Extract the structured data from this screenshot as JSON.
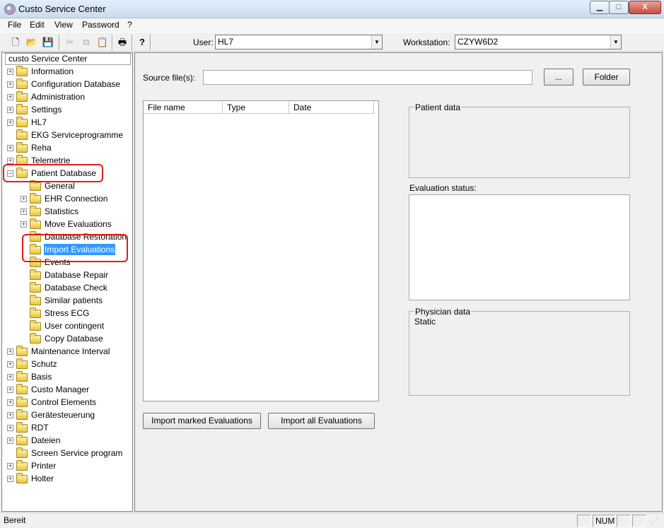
{
  "window": {
    "title": "Custo Service Center",
    "min_label": "▁",
    "max_label": "□",
    "close_label": "X"
  },
  "menu": [
    "File",
    "Edit",
    "View",
    "Password",
    "?"
  ],
  "toolbar": {
    "icons": [
      "new-icon",
      "open-icon",
      "save-icon",
      "cut-icon",
      "copy-icon",
      "paste-icon",
      "print-icon",
      "help-icon"
    ],
    "user_label": "User:",
    "user_value": "HL7",
    "workstation_label": "Workstation:",
    "workstation_value": "CZYW6D2"
  },
  "tree": {
    "root": "custo Service Center",
    "items": [
      {
        "label": "Information",
        "expander": "+",
        "level": 0
      },
      {
        "label": "Configuration Database",
        "expander": "+",
        "level": 0
      },
      {
        "label": "Administration",
        "expander": "+",
        "level": 0
      },
      {
        "label": "Settings",
        "expander": "+",
        "level": 0
      },
      {
        "label": "HL7",
        "expander": "+",
        "level": 0
      },
      {
        "label": "EKG Serviceprogramme",
        "expander": "",
        "level": 0
      },
      {
        "label": "Reha",
        "expander": "+",
        "level": 0
      },
      {
        "label": "Telemetrie",
        "expander": "+",
        "level": 0
      },
      {
        "label": "Patient Database",
        "expander": "−",
        "level": 0
      },
      {
        "label": "General",
        "expander": "",
        "level": 1
      },
      {
        "label": "EHR Connection",
        "expander": "+",
        "level": 1
      },
      {
        "label": "Statistics",
        "expander": "+",
        "level": 1
      },
      {
        "label": "Move Evaluations",
        "expander": "+",
        "level": 1
      },
      {
        "label": "Database Restoration",
        "expander": "",
        "level": 1
      },
      {
        "label": "Import Evaluations",
        "expander": "",
        "level": 1,
        "selected": true
      },
      {
        "label": "Events",
        "expander": "",
        "level": 1
      },
      {
        "label": "Database Repair",
        "expander": "",
        "level": 1
      },
      {
        "label": "Database Check",
        "expander": "",
        "level": 1
      },
      {
        "label": "Similar patients",
        "expander": "",
        "level": 1
      },
      {
        "label": "Stress ECG",
        "expander": "",
        "level": 1
      },
      {
        "label": "User contingent",
        "expander": "",
        "level": 1
      },
      {
        "label": "Copy Database",
        "expander": "",
        "level": 1
      },
      {
        "label": "Maintenance Interval",
        "expander": "+",
        "level": 0
      },
      {
        "label": "Schutz",
        "expander": "+",
        "level": 0
      },
      {
        "label": "Basis",
        "expander": "+",
        "level": 0
      },
      {
        "label": "Custo Manager",
        "expander": "+",
        "level": 0
      },
      {
        "label": "Control Elements",
        "expander": "+",
        "level": 0
      },
      {
        "label": "Gerätesteuerung",
        "expander": "+",
        "level": 0
      },
      {
        "label": "RDT",
        "expander": "+",
        "level": 0
      },
      {
        "label": "Dateien",
        "expander": "+",
        "level": 0
      },
      {
        "label": "Screen Service program",
        "expander": "",
        "level": 0
      },
      {
        "label": "Printer",
        "expander": "+",
        "level": 0
      },
      {
        "label": "Holter",
        "expander": "+",
        "level": 0
      }
    ]
  },
  "main": {
    "source_label": "Source file(s):",
    "source_value": "",
    "browse_label": "...",
    "folder_label": "Folder",
    "columns": [
      "File name",
      "Type",
      "Date"
    ],
    "patient_data_title": "Patient data",
    "evaluation_status_label": "Evaluation status:",
    "physician_data_title": "Physician data",
    "physician_data_value": "Static",
    "import_marked_label": "Import marked Evaluations",
    "import_all_label": "Import all Evaluations"
  },
  "status": {
    "text": "Bereit",
    "num": "NUM"
  },
  "colors": {
    "selection": "#3399ff",
    "highlight": "#e21b1b"
  }
}
